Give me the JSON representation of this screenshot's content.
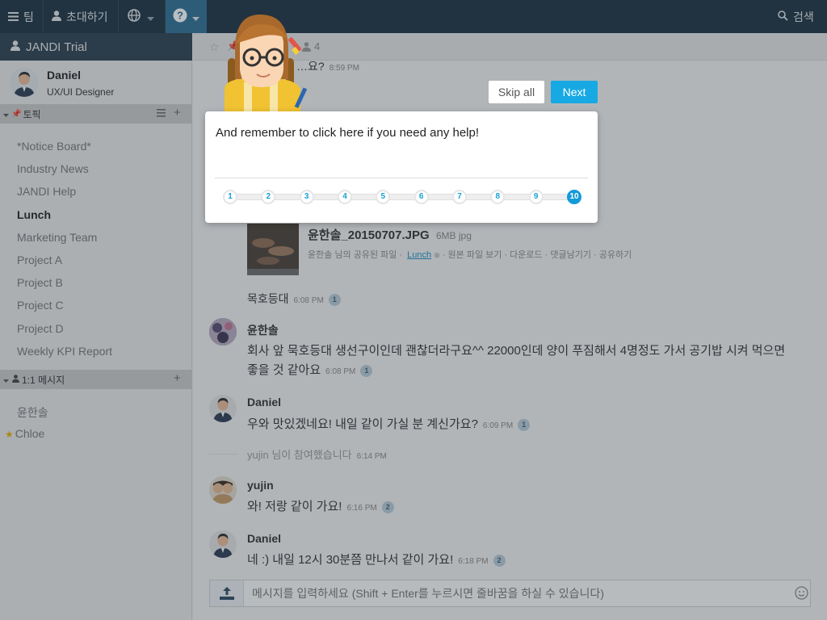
{
  "topbar": {
    "team_label": "팀",
    "invite_label": "초대하기",
    "search_label": "검색"
  },
  "sidebar": {
    "team_name": "JANDI Trial",
    "profile": {
      "name": "Daniel",
      "role": "UX/UI Designer"
    },
    "topics_header": "토픽",
    "topics": [
      "*Notice Board*",
      "Industry News",
      "JANDI Help",
      "Lunch",
      "Marketing Team",
      "Project A",
      "Project B",
      "Project C",
      "Project D",
      "Weekly KPI Report"
    ],
    "active_topic": "Lunch",
    "dm_header": "1:1 메시지",
    "dms": [
      "윤한솔",
      "Chloe"
    ]
  },
  "channel": {
    "member_count": "4",
    "partial_message": "…요?",
    "partial_time": "8:59 PM"
  },
  "file_card": {
    "filename": "윤한솔_20150707.JPG",
    "size": "6MB jpg",
    "shared_by": "윤한솔 님의 공유된 파일 ·",
    "topic_link": "Lunch",
    "actions": "· 원본 파일 보기 · 다운로드 · 댓글남기기 · 공유하기"
  },
  "messages": [
    {
      "author": "",
      "text": "목호등대",
      "time": "6:08 PM",
      "count": "1"
    },
    {
      "author": "윤한솔",
      "text": "회사 앞 묵호등대 생선구이인데 괜찮더라구요^^ 22000인데 양이 푸짐해서 4명정도 가서 공기밥 시켜 먹으면",
      "text2": "좋을 것 같아요",
      "time": "6:08 PM",
      "count": "1"
    },
    {
      "author": "Daniel",
      "text": "우와 맛있겠네요! 내일 같이 가실 분 계신가요?",
      "time": "6:09 PM",
      "count": "1"
    },
    {
      "author": "",
      "text": "yujin 님이 참여했습니다",
      "time": "6:14 PM",
      "count": ""
    },
    {
      "author": "yujin",
      "text": "와! 저랑 같이 가요!",
      "time": "6:16 PM",
      "count": "2"
    },
    {
      "author": "Daniel",
      "text": "네 :) 내일 12시 30분쯤 만나서 같이 가요!",
      "time": "6:18 PM",
      "count": "2"
    }
  ],
  "composer": {
    "placeholder": "메시지를 입력하세요 (Shift + Enter를 누르시면 줄바꿈을 하실 수 있습니다)"
  },
  "tour": {
    "message": "And remember to click here if you need any help!",
    "skip_label": "Skip all",
    "next_label": "Next",
    "steps": [
      "1",
      "2",
      "3",
      "4",
      "5",
      "6",
      "7",
      "8",
      "9",
      "10"
    ],
    "active_step": "10"
  },
  "colors": {
    "topbar": "#1d3140",
    "accent": "#17a9e3",
    "help_button": "#2e6d94"
  }
}
